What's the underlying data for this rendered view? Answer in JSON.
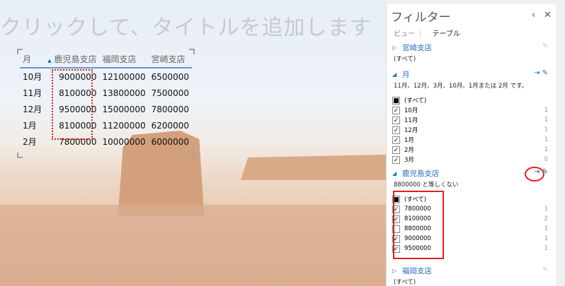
{
  "slide": {
    "title_placeholder": "クリックして、タイトルを追加します",
    "table": {
      "headers": [
        "月",
        "鹿児島支店",
        "福岡支店",
        "宮崎支店"
      ],
      "sort_icon": "sort-ascending-icon",
      "rows": [
        [
          "10月",
          "9000000",
          "12100000",
          "6500000"
        ],
        [
          "11月",
          "8100000",
          "13800000",
          "7500000"
        ],
        [
          "12月",
          "9500000",
          "15000000",
          "7800000"
        ],
        [
          "1月",
          "8100000",
          "11200000",
          "6200000"
        ],
        [
          "2月",
          "7800000",
          "10000000",
          "6000000"
        ]
      ]
    }
  },
  "panel": {
    "title": "フィルター",
    "back": "‹",
    "close": "✕",
    "tabs": [
      "ビュー",
      "テーブル"
    ],
    "sections": [
      {
        "name": "宮崎支店",
        "summary": "(すべて)",
        "expanded": false
      },
      {
        "name": "月",
        "summary": "11月、12月、3月、10月、1月または 2月 です。",
        "expanded": true,
        "items": [
          {
            "label": "(すべて)",
            "state": "partial",
            "count": ""
          },
          {
            "label": "10月",
            "state": "checked",
            "count": "1"
          },
          {
            "label": "11月",
            "state": "checked",
            "count": "1"
          },
          {
            "label": "12月",
            "state": "checked",
            "count": "1"
          },
          {
            "label": "1月",
            "state": "checked",
            "count": "1"
          },
          {
            "label": "2月",
            "state": "checked",
            "count": "1"
          },
          {
            "label": "3月",
            "state": "checked",
            "count": "0"
          }
        ]
      },
      {
        "name": "鹿児島支店",
        "summary": "8800000 と等しくない",
        "expanded": true,
        "items": [
          {
            "label": "(すべて)",
            "state": "partial",
            "count": ""
          },
          {
            "label": "7800000",
            "state": "checked",
            "count": "1"
          },
          {
            "label": "8100000",
            "state": "checked",
            "count": "2"
          },
          {
            "label": "8800000",
            "state": "unchecked",
            "count": "1"
          },
          {
            "label": "9000000",
            "state": "checked",
            "count": "1"
          },
          {
            "label": "9500000",
            "state": "checked",
            "count": "1"
          }
        ]
      },
      {
        "name": "福岡支店",
        "summary": "(すべて)",
        "expanded": false
      }
    ]
  }
}
